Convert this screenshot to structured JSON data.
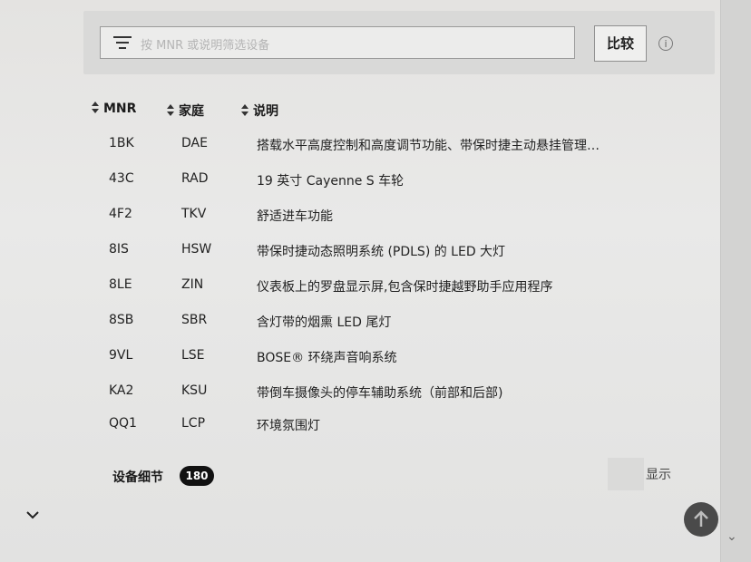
{
  "filter": {
    "placeholder": "按 MNR 或说明筛选设备",
    "compare_label": "比较",
    "info_symbol": "i"
  },
  "table": {
    "headers": {
      "mnr": "MNR",
      "family": "家庭",
      "description": "说明"
    },
    "rows": [
      {
        "mnr": "1BK",
        "family": "DAE",
        "description": "搭载水平高度控制和高度调节功能、带保时捷主动悬挂管理…"
      },
      {
        "mnr": "43C",
        "family": "RAD",
        "description": "19 英寸 Cayenne S 车轮"
      },
      {
        "mnr": "4F2",
        "family": "TKV",
        "description": "舒适进车功能"
      },
      {
        "mnr": "8IS",
        "family": "HSW",
        "description": "带保时捷动态照明系统 (PDLS) 的 LED 大灯"
      },
      {
        "mnr": "8LE",
        "family": "ZIN",
        "description": "仪表板上的罗盘显示屏,包含保时捷越野助手应用程序"
      },
      {
        "mnr": "8SB",
        "family": "SBR",
        "description": "含灯带的烟熏 LED 尾灯"
      },
      {
        "mnr": "9VL",
        "family": "LSE",
        "description": "BOSE® 环绕声音响系统"
      },
      {
        "mnr": "KA2",
        "family": "KSU",
        "description": "带倒车摄像头的停车辅助系统（前部和后部)"
      },
      {
        "mnr": "QQ1",
        "family": "LCP",
        "description": "环境氛围灯"
      }
    ]
  },
  "footer": {
    "details_label": "设备细节",
    "details_count": "180",
    "show_label": "显示"
  },
  "icons": {
    "filter": "filter-icon",
    "sort": "sort-icon",
    "info": "info-icon",
    "chevron_down": "chevron-down-icon",
    "scroll_top": "arrow-up-icon"
  }
}
